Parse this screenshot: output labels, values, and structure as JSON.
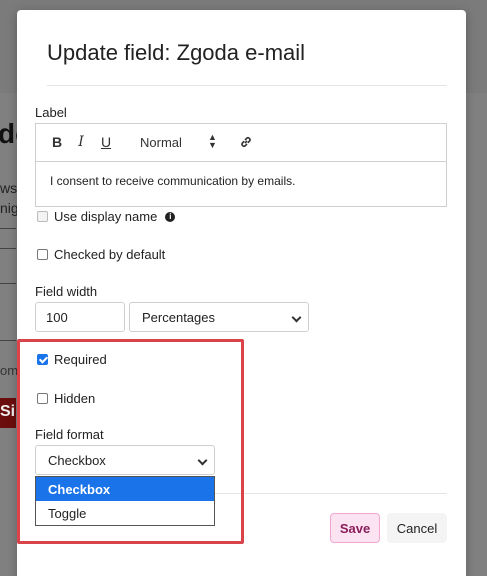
{
  "background": {
    "heading": "do",
    "line1": "ws,",
    "line2": "nigh",
    "faint": "om",
    "button": "Si"
  },
  "modal": {
    "title": "Update field: Zgoda e-mail",
    "label_caption": "Label",
    "toolbar": {
      "bold": "B",
      "italic": "I",
      "underline": "U",
      "size": "Normal",
      "size_arrows_up": "▲",
      "size_arrows_down": "▼",
      "link_icon": "link-icon"
    },
    "label_text": "I consent to receive communication by emails.",
    "use_display_name": "Use display name",
    "info_icon": "i",
    "checked_by_default": "Checked by default",
    "field_width_caption": "Field width",
    "field_width_value": "100",
    "field_width_unit": "Percentages",
    "required": "Required",
    "hidden": "Hidden",
    "field_format_caption": "Field format",
    "field_format_value": "Checkbox",
    "field_format_options": [
      "Checkbox",
      "Toggle"
    ],
    "save": "Save",
    "cancel": "Cancel",
    "highlight_color": "#d9434a",
    "accent_color": "#1a73e8"
  }
}
